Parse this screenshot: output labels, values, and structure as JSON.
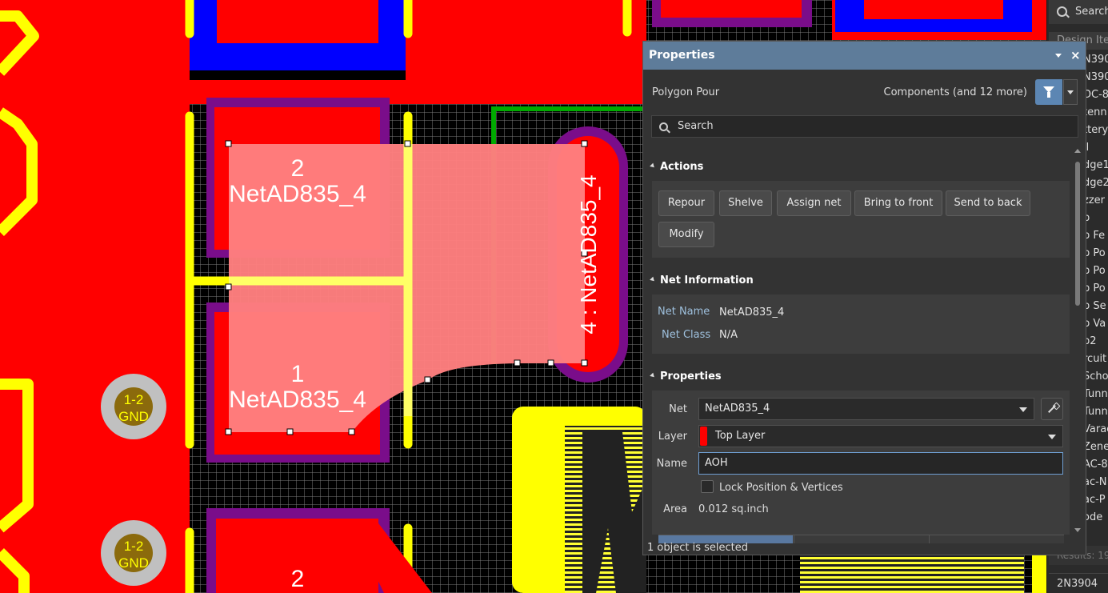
{
  "pcb": {
    "pad_labels": [
      {
        "num": "2",
        "net": "NetAD835_4"
      },
      {
        "num": "1",
        "net": "NetAD835_4"
      },
      {
        "num": "2"
      }
    ],
    "vertical_pad_label": "4 : NetAD835_4",
    "hole_labels": [
      {
        "line1": "1-2",
        "line2": "GND"
      },
      {
        "line1": "1-2",
        "line2": "GND"
      }
    ],
    "colors": {
      "top_layer": "#ff0000",
      "overlay": "#ffff00",
      "selection": "#ff7f7f",
      "keepout": "#7a0d8a",
      "blue_layer": "#0000ff",
      "green_outline": "#008000"
    }
  },
  "side_panel": {
    "search_label": "Search",
    "header": "Design Ite",
    "items": [
      "N390",
      "N390",
      "DC-8",
      "tenn",
      "ttery",
      "ll",
      "dge1",
      "dge2",
      "zzer",
      "p",
      "p Fe",
      "p Po",
      "p Po",
      "p Po",
      "p Se",
      "p Va",
      "p2",
      "rcuit",
      "Scho",
      "Tunn",
      "Tunn",
      "Varac",
      "Zene",
      "AC-8",
      "ac-N",
      "ac-P",
      "ode"
    ],
    "results": "Results: 19",
    "footer": "2N3904"
  },
  "properties": {
    "title": "Properties",
    "close_glyph": "×",
    "object_type": "Polygon Pour",
    "filter_text": "Components (and 12 more)",
    "search_placeholder": "Search",
    "sections": {
      "actions": "Actions",
      "net_information": "Net Information",
      "properties": "Properties"
    },
    "actions": [
      "Repour",
      "Shelve",
      "Assign net",
      "Bring to front",
      "Send to back",
      "Modify"
    ],
    "net_info": {
      "net_name_label": "Net Name",
      "net_name": "NetAD835_4",
      "net_class_label": "Net Class",
      "net_class": "N/A"
    },
    "fields": {
      "net_label": "Net",
      "net_value": "NetAD835_4",
      "layer_label": "Layer",
      "layer_value": "Top Layer",
      "layer_color": "#ff0000",
      "name_label": "Name",
      "name_value": "AOH",
      "lock_label": "Lock Position & Vertices",
      "area_label": "Area",
      "area_value": "0.012 sq.inch"
    },
    "status": "1 object is selected"
  }
}
